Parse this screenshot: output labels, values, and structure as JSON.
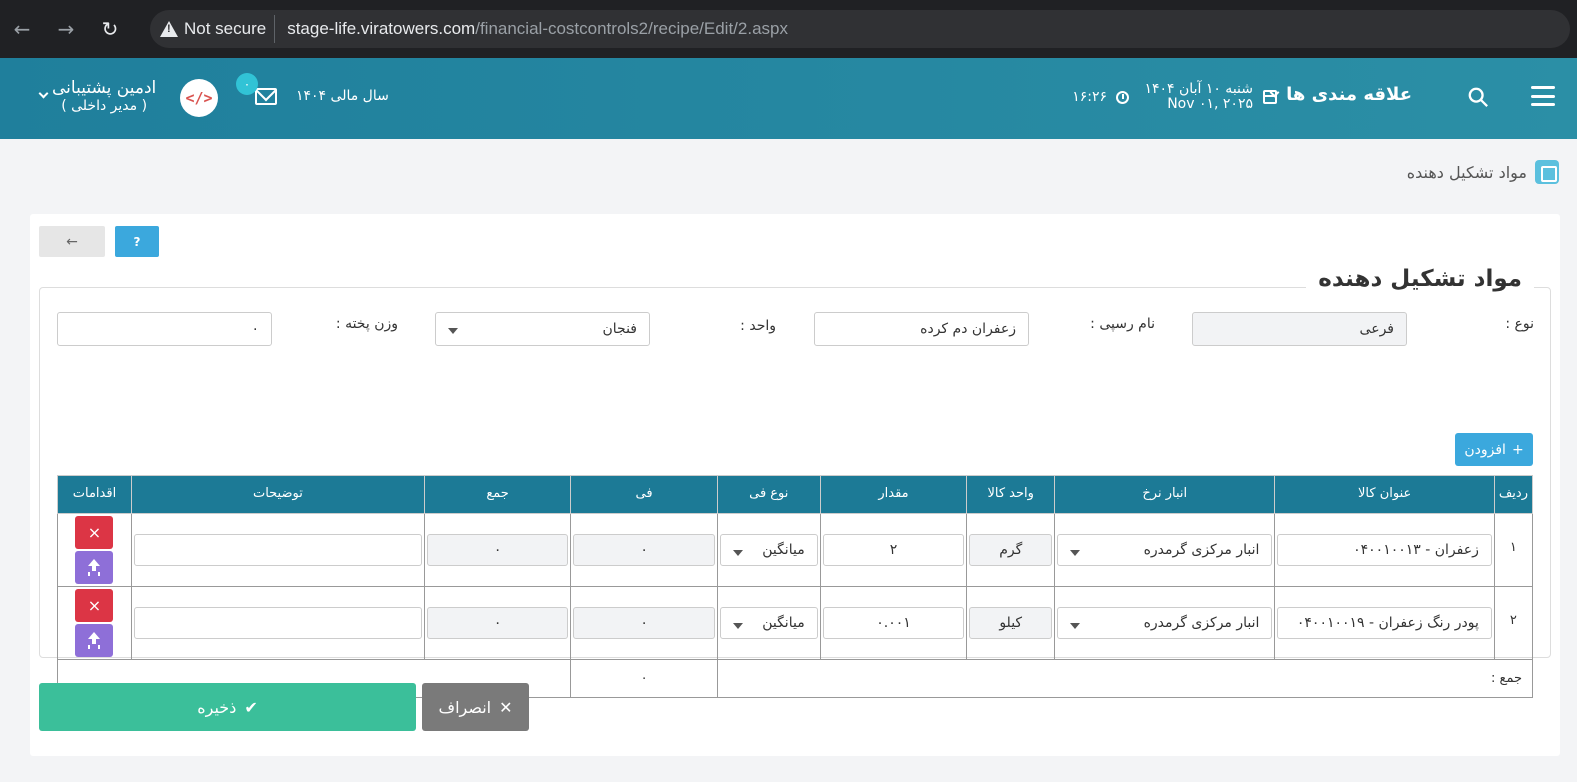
{
  "browser": {
    "security": "Not secure",
    "url_host": "stage-life.viratowers.com",
    "url_path": "/financial-costcontrols2/recipe/Edit/2.aspx"
  },
  "header": {
    "favorites": "علاقه مندی ها",
    "date_fa": "شنبه ۱۰ آبان ۱۴۰۴",
    "date_en": "Nov ۰۱, ۲۰۲۵",
    "time": "۱۶:۲۶",
    "fiscal_year": "سال مالی ۱۴۰۴",
    "mail_count": "۰",
    "user_name": "ادمین پشتیبانی",
    "user_role": "( مدیر داخلی )",
    "avatar_text": "</>"
  },
  "page": {
    "title": "مواد تشکیل دهنده"
  },
  "toolbar": {
    "back_label": "←",
    "help_label": "?"
  },
  "form": {
    "legend": "مواد تشکیل دهنده",
    "type_label": "نوع :",
    "type_value": "فرعی",
    "recipe_name_label": "نام رسپی :",
    "recipe_name_value": "زعفران دم کرده",
    "unit_label": "واحد :",
    "unit_value": "فنجان",
    "cook_weight_label": "وزن پخته :",
    "cook_weight_value": "۰",
    "add_label": "افزودن"
  },
  "table": {
    "headers": [
      "ردیف",
      "عنوان کالا",
      "انبار نرخ",
      "واحد کالا",
      "مقدار",
      "نوع فی",
      "فی",
      "جمع",
      "توضیحات",
      "اقدامات"
    ],
    "rows": [
      {
        "num": "۱",
        "item": "زعفران - ۰۴۰۰۱۰۰۱۳",
        "warehouse": "انبار مرکزی گرمدره",
        "unit": "گرم",
        "qty": "۲",
        "price_type": "میانگین",
        "price": "۰",
        "total": "۰",
        "desc": ""
      },
      {
        "num": "۲",
        "item": "پودر رنگ زعفران - ۰۴۰۰۱۰۰۱۹",
        "warehouse": "انبار مرکزی گرمدره",
        "unit": "کیلو",
        "qty": "۰.۰۰۱",
        "price_type": "میانگین",
        "price": "۰",
        "total": "۰",
        "desc": ""
      }
    ],
    "sum_label": "جمع :",
    "sum_value": "۰"
  },
  "actions": {
    "save_label": "ذخیره",
    "cancel_label": "انصراف"
  },
  "icons": {
    "delete": "×",
    "check": "✔",
    "close": "✕",
    "plus": "+"
  },
  "colors": {
    "header_bg": "#1f7f9c",
    "table_header": "#1c7a96",
    "save": "#3bbf9a",
    "cancel": "#7a7a7a",
    "delete": "#dc3545",
    "upload": "#8e6fd8",
    "info": "#3ba8dd"
  }
}
